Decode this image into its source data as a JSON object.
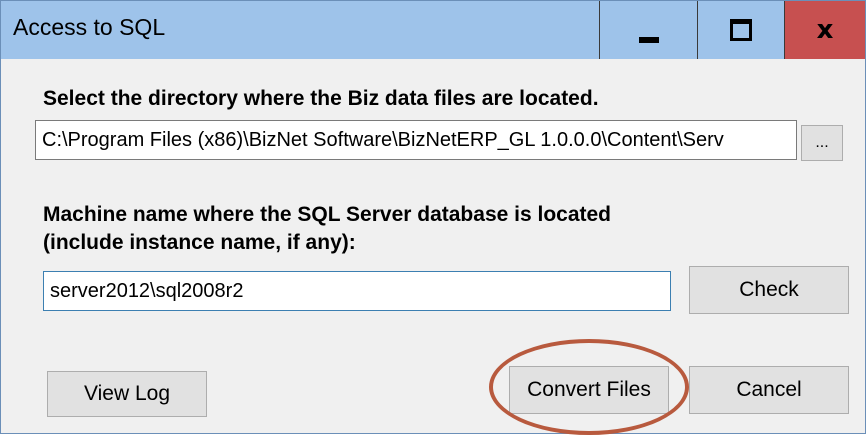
{
  "window": {
    "title": "Access to SQL",
    "controls": {
      "minimize_icon": "minimize-icon",
      "maximize_icon": "maximize-icon",
      "close_glyph": "x"
    }
  },
  "directory": {
    "label": "Select the directory where the Biz data files are located.",
    "value": "C:\\Program Files (x86)\\BizNet Software\\BizNetERP_GL 1.0.0.0\\Content\\Serv",
    "browse_label": "..."
  },
  "machine": {
    "label_line1": "Machine name where the SQL Server database is located",
    "label_line2": "(include instance name, if any):",
    "value": "server2012\\sql2008r2",
    "check_label": "Check"
  },
  "footer": {
    "view_log_label": "View Log",
    "convert_label": "Convert Files",
    "cancel_label": "Cancel"
  },
  "colors": {
    "titlebar": "#9ec3ea",
    "close_button": "#c75050",
    "annotation": "#b85a3e"
  }
}
